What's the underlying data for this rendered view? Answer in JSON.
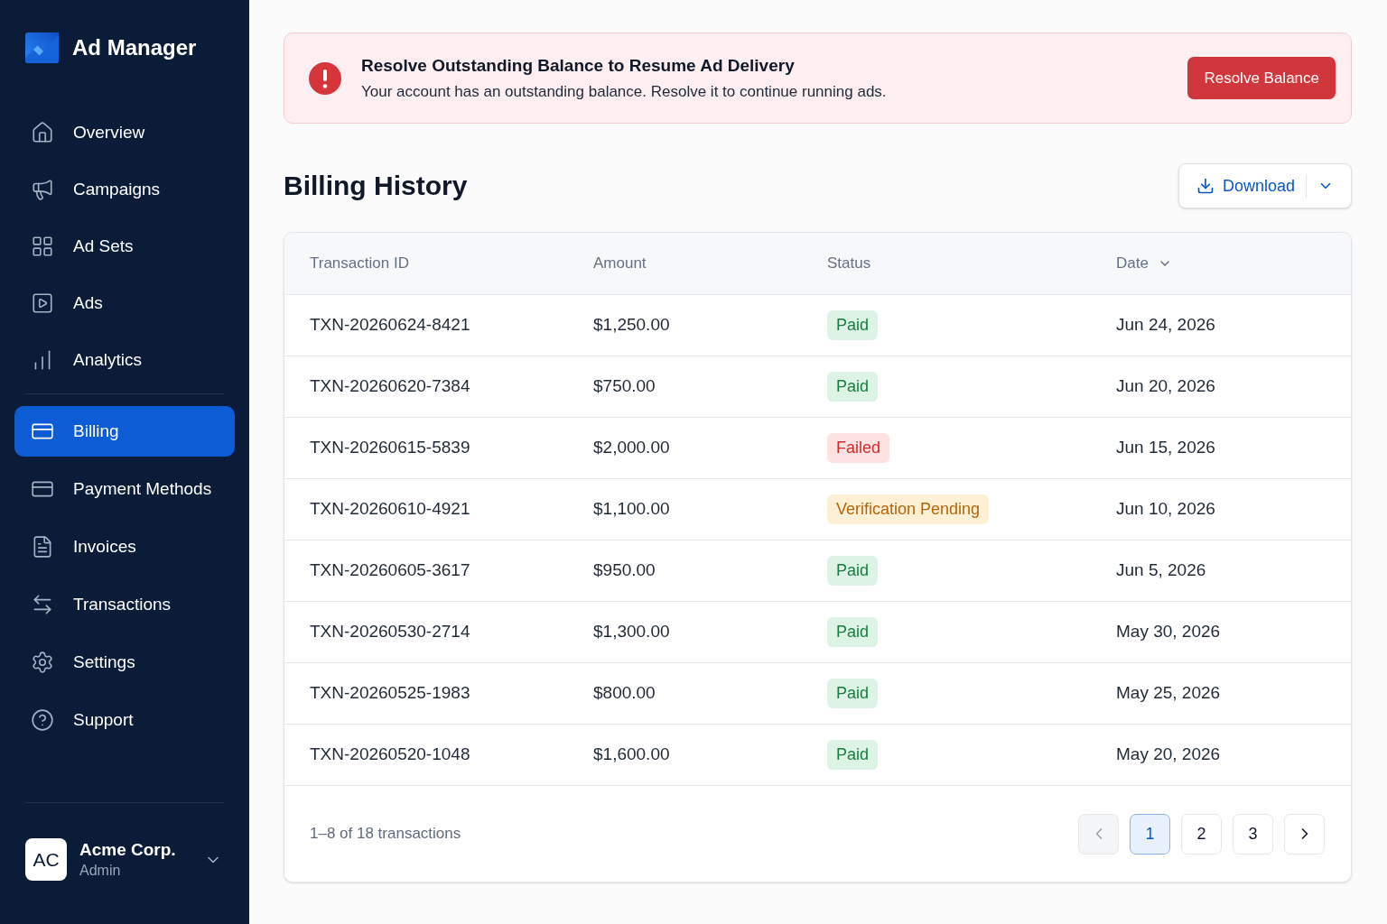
{
  "sidebar": {
    "brand": "Ad Manager",
    "nav_groups": [
      {
        "items": [
          {
            "label": "Overview",
            "selected": false
          },
          {
            "label": "Campaigns",
            "selected": false
          },
          {
            "label": "Ad Sets",
            "selected": false
          },
          {
            "label": "Ads",
            "selected": false
          },
          {
            "label": "Analytics",
            "selected": false
          }
        ]
      },
      {
        "items": [
          {
            "label": "Billing",
            "selected": true
          },
          {
            "label": "Payment Methods",
            "selected": false
          },
          {
            "label": "Invoices",
            "selected": false
          },
          {
            "label": "Transactions",
            "selected": false
          },
          {
            "label": "Settings",
            "selected": false
          },
          {
            "label": "Support",
            "selected": false
          }
        ]
      }
    ],
    "account": {
      "initials": "AC",
      "name": "Acme Corp.",
      "role": "Admin"
    }
  },
  "alert": {
    "title": "Resolve Outstanding Balance to Resume Ad Delivery",
    "message": "Your account has an outstanding balance. Resolve it to continue running ads.",
    "action": "Resolve Balance"
  },
  "page": {
    "title": "Billing History",
    "download": "Download"
  },
  "table": {
    "columns": [
      {
        "label": "Transaction ID",
        "sorted": false
      },
      {
        "label": "Amount",
        "sorted": false
      },
      {
        "label": "Status",
        "sorted": false
      },
      {
        "label": "Date",
        "sorted": true
      }
    ],
    "rows": [
      {
        "id": "TXN-20260624-8421",
        "amount": "$1,250.00",
        "status": {
          "label": "Paid",
          "kind": "success"
        },
        "date": "Jun 24, 2026"
      },
      {
        "id": "TXN-20260620-7384",
        "amount": "$750.00",
        "status": {
          "label": "Paid",
          "kind": "success"
        },
        "date": "Jun 20, 2026"
      },
      {
        "id": "TXN-20260615-5839",
        "amount": "$2,000.00",
        "status": {
          "label": "Failed",
          "kind": "error"
        },
        "date": "Jun 15, 2026"
      },
      {
        "id": "TXN-20260610-4921",
        "amount": "$1,100.00",
        "status": {
          "label": "Verification Pending",
          "kind": "warning"
        },
        "date": "Jun 10, 2026"
      },
      {
        "id": "TXN-20260605-3617",
        "amount": "$950.00",
        "status": {
          "label": "Paid",
          "kind": "success"
        },
        "date": "Jun 5, 2026"
      },
      {
        "id": "TXN-20260530-2714",
        "amount": "$1,300.00",
        "status": {
          "label": "Paid",
          "kind": "success"
        },
        "date": "May 30, 2026"
      },
      {
        "id": "TXN-20260525-1983",
        "amount": "$800.00",
        "status": {
          "label": "Paid",
          "kind": "success"
        },
        "date": "May 25, 2026"
      },
      {
        "id": "TXN-20260520-1048",
        "amount": "$1,600.00",
        "status": {
          "label": "Paid",
          "kind": "success"
        },
        "date": "May 20, 2026"
      }
    ],
    "summary": "1–8 of 18 transactions",
    "pagination": {
      "previous": {
        "disabled": true
      },
      "pages": [
        {
          "label": "1",
          "selected": true
        },
        {
          "label": "2",
          "selected": false
        },
        {
          "label": "3",
          "selected": false
        }
      ],
      "next": {
        "disabled": false
      }
    }
  }
}
